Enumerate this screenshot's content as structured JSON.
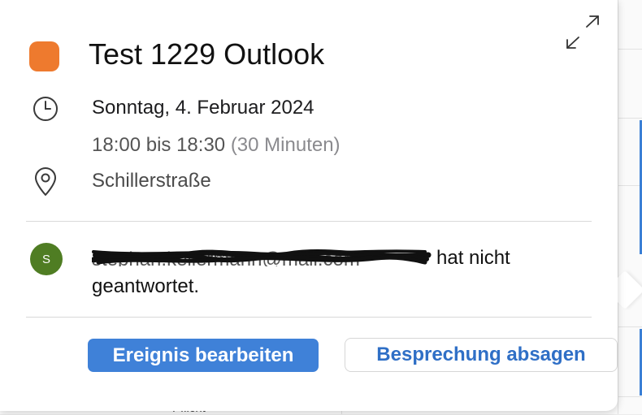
{
  "event": {
    "title": "Test 1229 Outlook",
    "calendar_color": "#ee7a2e",
    "date": "Sonntag, 4. Februar 2024",
    "time_range": "18:00 bis 18:30",
    "duration": "(30 Minuten)",
    "location": "Schillerstraße"
  },
  "attendee": {
    "avatar_initial": "S",
    "avatar_color": "#4f7d23",
    "redacted_email": "stephan.kellermann@mail.com",
    "status_text": "hat nicht geantwortet."
  },
  "actions": {
    "edit_label": "Ereignis bearbeiten",
    "cancel_label": "Besprechung absagen"
  },
  "icons": {
    "expand": "expand-icon",
    "clock": "clock-icon",
    "location": "location-pin-icon"
  },
  "background": {
    "partial_text": "Pflicht"
  },
  "colors": {
    "primary_button": "#3f81d8",
    "link_blue": "#2f6fc6"
  }
}
